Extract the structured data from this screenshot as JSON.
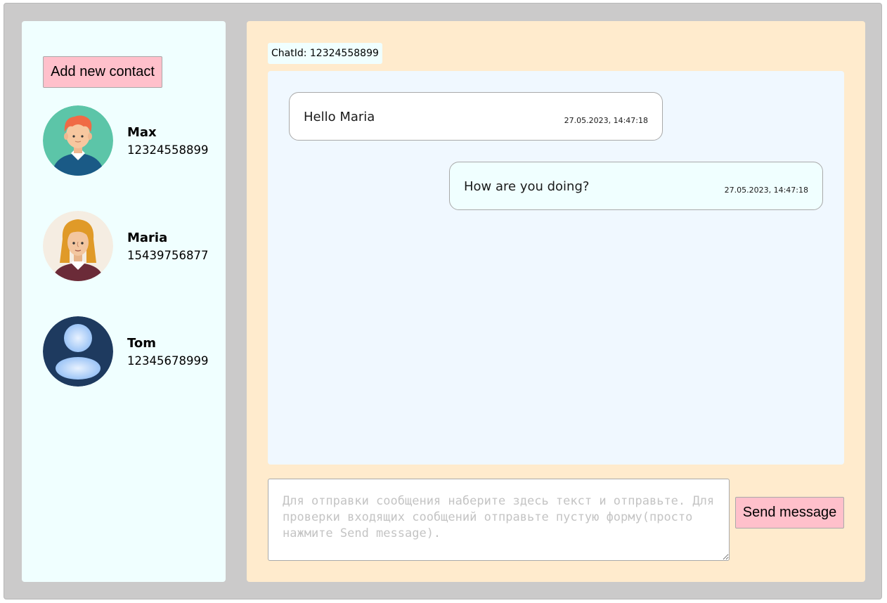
{
  "sidebar": {
    "add_button_label": "Add new contact",
    "contacts": [
      {
        "name": "Max",
        "phone": "12324558899",
        "avatar_icon": "avatar-man-red-hair-icon"
      },
      {
        "name": "Maria",
        "phone": "15439756877",
        "avatar_icon": "avatar-woman-blonde-icon"
      },
      {
        "name": "Tom",
        "phone": "12345678999",
        "avatar_icon": "default-user-icon"
      }
    ]
  },
  "chat": {
    "chat_id_label": "ChatId: 12324558899",
    "messages": [
      {
        "direction": "incoming",
        "text": "Hello Maria",
        "timestamp": "27.05.2023, 14:47:18"
      },
      {
        "direction": "outgoing",
        "text": "How are you doing?",
        "timestamp": "27.05.2023, 14:47:18"
      }
    ],
    "input": {
      "value": "",
      "placeholder": "Для отправки сообщения наберите здесь текст и отправьте. Для проверки входящих сообщений отправьте пустую форму(просто нажмите Send message)."
    },
    "send_button_label": "Send message"
  },
  "colors": {
    "background": "#cbcaca",
    "sidebar": "#f0ffff",
    "chat_panel": "#ffebcd",
    "messages_area": "#f0f8ff",
    "button": "#ffc0cb"
  }
}
